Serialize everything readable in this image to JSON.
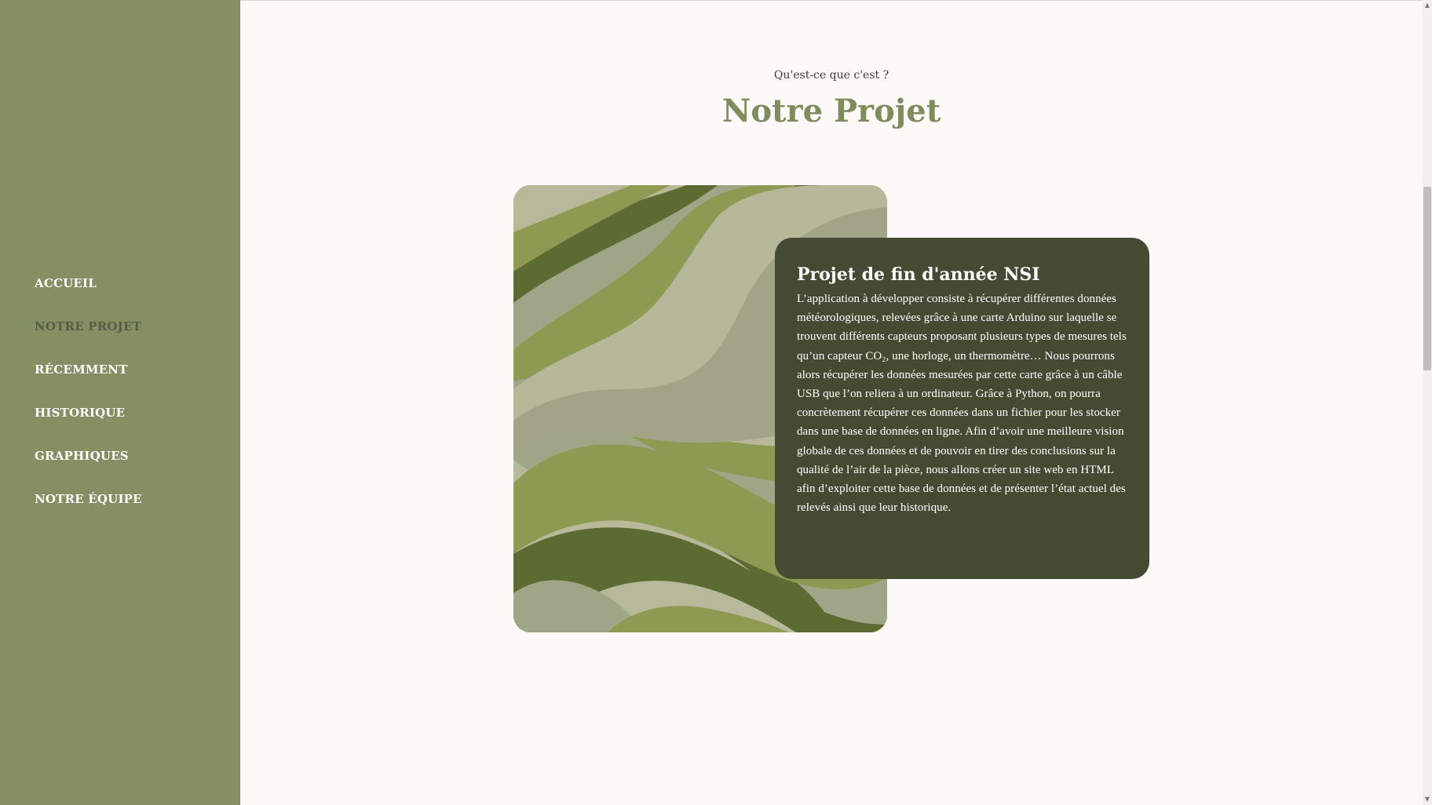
{
  "nav": {
    "items": [
      {
        "label": "ACCUEIL"
      },
      {
        "label": "NOTRE PROJET"
      },
      {
        "label": "RÉCEMMENT"
      },
      {
        "label": "HISTORIQUE"
      },
      {
        "label": "GRAPHIQUES"
      },
      {
        "label": "NOTRE ÉQUIPE"
      }
    ],
    "active": "NOTRE PROJET"
  },
  "section": {
    "eyebrow": "Qu'est-ce que c'est ?",
    "title": "Notre Projet"
  },
  "card": {
    "title": "Projet de fin d'année NSI",
    "body": "L’application à développer consiste à récupérer différentes données météorologiques, relevées grâce à une carte Arduino sur laquelle se trouvent différents capteurs proposant plusieurs types de mesures tels qu’un capteur CO₂, une horloge, un thermomètre… Nous pourrons alors récupérer les données mesurées par cette carte grâce à un câble USB que l’on reliera à un ordinateur. Grâce à Python, on pourra concrètement récupérer ces données dans un fichier pour les stocker dans une base de données en ligne. Afin d’avoir une meilleure vision globale de ces données et de pouvoir en tirer des conclusions sur la qualité de l’air de la pièce, nous allons créer un site web en HTML afin d’exploiter cette base de données et de présenter l’état actuel des relevés ainsi que leur historique."
  },
  "icons": {
    "scroll_up": "scroll-up-arrow-icon",
    "scroll_down": "scroll-down-arrow-icon"
  },
  "colors": {
    "sidebar": "#848f63",
    "accent": "#7f8c5e",
    "card": "#454a33",
    "active_nav": "#5b5a47"
  }
}
